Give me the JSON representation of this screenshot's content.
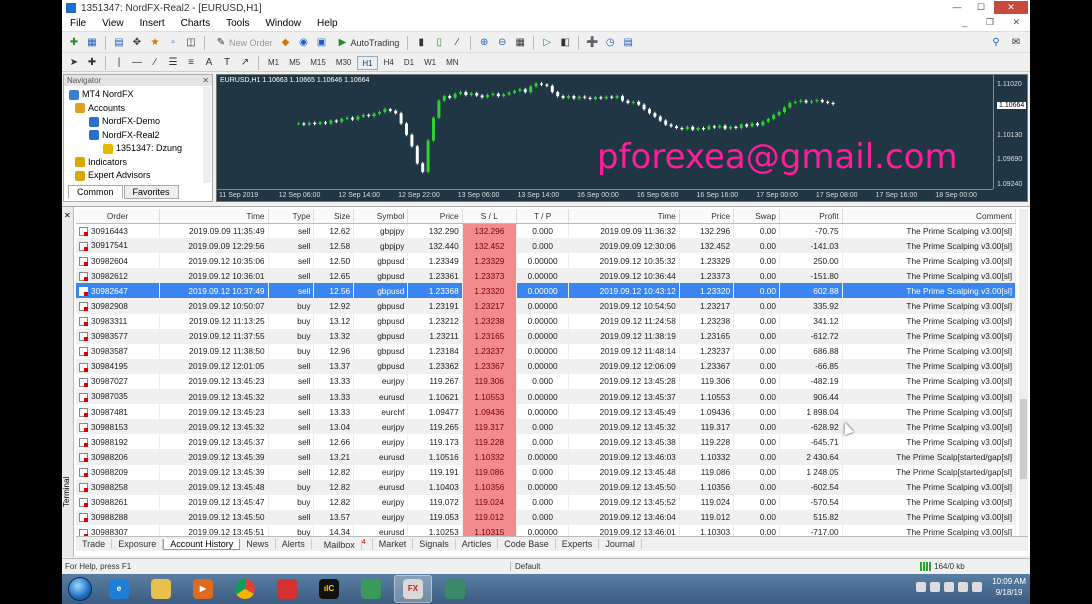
{
  "window": {
    "title": "1351347: NordFX-Real2 - [EURUSD,H1]",
    "controls": [
      "minimize",
      "maximize",
      "close"
    ]
  },
  "menu": [
    "File",
    "View",
    "Insert",
    "Charts",
    "Tools",
    "Window",
    "Help"
  ],
  "toolbar": {
    "new_order": "New Order",
    "auto_trading": "AutoTrading",
    "timeframes": [
      "M1",
      "M5",
      "M15",
      "M30",
      "H1",
      "H4",
      "D1",
      "W1",
      "MN"
    ],
    "active_timeframe": "H1"
  },
  "navigator": {
    "title": "Navigator",
    "items": [
      {
        "label": "MT4 NordFX",
        "icon": "terminal-icon"
      },
      {
        "label": "Accounts",
        "icon": "accounts-icon"
      },
      {
        "label": "NordFX-Demo",
        "icon": "server-icon"
      },
      {
        "label": "NordFX-Real2",
        "icon": "server-icon"
      },
      {
        "label": "1351347: Dzung",
        "icon": "lock-icon"
      },
      {
        "label": "Indicators",
        "icon": "indicators-icon"
      },
      {
        "label": "Expert Advisors",
        "icon": "expert-advisors-icon"
      }
    ],
    "tabs": [
      "Common",
      "Favorites"
    ],
    "active_tab": "Common"
  },
  "chart": {
    "header": "EURUSD,H1  1.10663 1.10665 1.10646 1.10664",
    "price_labels": [
      "1.11020",
      "1.10664",
      "1.10130",
      "1.09690",
      "1.09240"
    ],
    "current_price": "1.10664",
    "time_labels": [
      "11 Sep 2019",
      "12 Sep 06:00",
      "12 Sep 14:00",
      "12 Sep 22:00",
      "13 Sep 06:00",
      "13 Sep 14:00",
      "16 Sep 00:00",
      "16 Sep 08:00",
      "16 Sep 16:00",
      "17 Sep 00:00",
      "17 Sep 08:00",
      "17 Sep 16:00",
      "18 Sep 00:00"
    ],
    "watermark": "pforexea@gmail.com",
    "colors": {
      "background": "#203644",
      "bull": "#2ed12e",
      "bear": "#ffffff",
      "watermark": "#ff1e9a"
    }
  },
  "chart_data": {
    "type": "candlestick",
    "title": "EURUSD,H1  1.10663 1.10665 1.10646 1.10664",
    "ylim": [
      1.0915,
      1.1115
    ],
    "series": [
      {
        "name": "EURUSD,H1",
        "close": [
          1.103,
          1.1028,
          1.1031,
          1.1029,
          1.1032,
          1.103,
          1.1035,
          1.1033,
          1.1038,
          1.104,
          1.1037,
          1.1042,
          1.1045,
          1.1043,
          1.1047,
          1.105,
          1.1055,
          1.1052,
          1.1048,
          1.103,
          1.101,
          1.099,
          1.096,
          1.0945,
          1.1,
          1.104,
          1.107,
          1.1078,
          1.1075,
          1.1082,
          1.1085,
          1.108,
          1.1083,
          1.1079,
          1.1076,
          1.108,
          1.1082,
          1.1078,
          1.1081,
          1.1084,
          1.1087,
          1.109,
          1.1085,
          1.1095,
          1.11,
          1.1098,
          1.1096,
          1.1085,
          1.1078,
          1.1075,
          1.1078,
          1.1074,
          1.1077,
          1.1075,
          1.1073,
          1.1076,
          1.1074,
          1.1077,
          1.1075,
          1.1078,
          1.107,
          1.1066,
          1.1068,
          1.1063,
          1.1055,
          1.1048,
          1.1042,
          1.1035,
          1.1028,
          1.1025,
          1.1022,
          1.102,
          1.1024,
          1.1019,
          1.1022,
          1.102,
          1.1025,
          1.1023,
          1.1026,
          1.1021,
          1.1024,
          1.1022,
          1.1028,
          1.1025,
          1.103,
          1.1027,
          1.1033,
          1.1038,
          1.1045,
          1.105,
          1.1058,
          1.1066,
          1.1068,
          1.107,
          1.1067,
          1.1069,
          1.1071,
          1.1068,
          1.1066,
          1.1064
        ]
      }
    ]
  },
  "history": {
    "columns": [
      "Order",
      "Time",
      "Type",
      "Size",
      "Symbol",
      "Price",
      "S / L",
      "T / P",
      "Time",
      "Price",
      "Swap",
      "Profit",
      "Comment"
    ],
    "rows": [
      [
        "30916443",
        "2019.09.09 11:35:49",
        "sell",
        "12.62",
        "gbpjpy",
        "132.290",
        "132.296",
        "0.000",
        "2019.09.09 11:36:32",
        "132.296",
        "0.00",
        "-70.75",
        "The Prime Scalping v3.00[sl]"
      ],
      [
        "30917541",
        "2019.09.09 12:29:56",
        "sell",
        "12.58",
        "gbpjpy",
        "132.440",
        "132.452",
        "0.000",
        "2019.09.09 12:30:06",
        "132.452",
        "0.00",
        "-141.03",
        "The Prime Scalping v3.00[sl]"
      ],
      [
        "30982604",
        "2019.09.12 10:35:06",
        "sell",
        "12.50",
        "gbpusd",
        "1.23349",
        "1.23329",
        "0.00000",
        "2019.09.12 10:35:32",
        "1.23329",
        "0.00",
        "250.00",
        "The Prime Scalping v3.00[sl]"
      ],
      [
        "30982612",
        "2019.09.12 10:36:01",
        "sell",
        "12.65",
        "gbpusd",
        "1.23361",
        "1.23373",
        "0.00000",
        "2019.09.12 10:36:44",
        "1.23373",
        "0.00",
        "-151.80",
        "The Prime Scalping v3.00[sl]"
      ],
      [
        "30982647",
        "2019.09.12 10:37:49",
        "sell",
        "12.56",
        "gbpusd",
        "1.23368",
        "1.23320",
        "0.00000",
        "2019.09.12 10:43:12",
        "1.23320",
        "0.00",
        "602.88",
        "The Prime Scalping v3.00[sl]"
      ],
      [
        "30982908",
        "2019.09.12 10:50:07",
        "buy",
        "12.92",
        "gbpusd",
        "1.23191",
        "1.23217",
        "0.00000",
        "2019.09.12 10:54:50",
        "1.23217",
        "0.00",
        "335.92",
        "The Prime Scalping v3.00[sl]"
      ],
      [
        "30983311",
        "2019.09.12 11:13:25",
        "buy",
        "13.12",
        "gbpusd",
        "1.23212",
        "1.23238",
        "0.00000",
        "2019.09.12 11:24:58",
        "1.23238",
        "0.00",
        "341.12",
        "The Prime Scalping v3.00[sl]"
      ],
      [
        "30983577",
        "2019.09.12 11:37:55",
        "buy",
        "13.32",
        "gbpusd",
        "1.23211",
        "1.23165",
        "0.00000",
        "2019.09.12 11:38:19",
        "1.23165",
        "0.00",
        "-612.72",
        "The Prime Scalping v3.00[sl]"
      ],
      [
        "30983587",
        "2019.09.12 11:38:50",
        "buy",
        "12.96",
        "gbpusd",
        "1.23184",
        "1.23237",
        "0.00000",
        "2019.09.12 11:48:14",
        "1.23237",
        "0.00",
        "686.88",
        "The Prime Scalping v3.00[sl]"
      ],
      [
        "30984195",
        "2019.09.12 12:01:05",
        "sell",
        "13.37",
        "gbpusd",
        "1.23362",
        "1.23367",
        "0.00000",
        "2019.09.12 12:06:09",
        "1.23367",
        "0.00",
        "-66.85",
        "The Prime Scalping v3.00[sl]"
      ],
      [
        "30987027",
        "2019.09.12 13:45:23",
        "sell",
        "13.33",
        "eurjpy",
        "119.267",
        "119.306",
        "0.000",
        "2019.09.12 13:45:28",
        "119.306",
        "0.00",
        "-482.19",
        "The Prime Scalping v3.00[sl]"
      ],
      [
        "30987035",
        "2019.09.12 13:45:32",
        "sell",
        "13.33",
        "eurusd",
        "1.10621",
        "1.10553",
        "0.00000",
        "2019.09.12 13:45:37",
        "1.10553",
        "0.00",
        "906.44",
        "The Prime Scalping v3.00[sl]"
      ],
      [
        "30987481",
        "2019.09.12 13:45:23",
        "sell",
        "13.33",
        "eurchf",
        "1.09477",
        "1.09436",
        "0.00000",
        "2019.09.12 13:45:49",
        "1.09436",
        "0.00",
        "1 898.04",
        "The Prime Scalping v3.00[sl]"
      ],
      [
        "30988153",
        "2019.09.12 13:45:32",
        "sell",
        "13.04",
        "eurjpy",
        "119.265",
        "119.317",
        "0.000",
        "2019.09.12 13:45:32",
        "119.317",
        "0.00",
        "-628.92",
        "The Prime Scalping v3.00[sl]"
      ],
      [
        "30988192",
        "2019.09.12 13:45:37",
        "sell",
        "12.66",
        "eurjpy",
        "119.173",
        "119.228",
        "0.000",
        "2019.09.12 13:45:38",
        "119.228",
        "0.00",
        "-645.71",
        "The Prime Scalping v3.00[sl]"
      ],
      [
        "30988206",
        "2019.09.12 13:45:39",
        "sell",
        "13.21",
        "eurusd",
        "1.10516",
        "1.10332",
        "0.00000",
        "2019.09.12 13:46:03",
        "1.10332",
        "0.00",
        "2 430.64",
        "The Prime Scalp[started/gap[sl]"
      ],
      [
        "30988209",
        "2019.09.12 13:45:39",
        "sell",
        "12.82",
        "eurjpy",
        "119.191",
        "119.086",
        "0.000",
        "2019.09.12 13:45:48",
        "119.086",
        "0.00",
        "1 248.05",
        "The Prime Scalp[started/gap[sl]"
      ],
      [
        "30988258",
        "2019.09.12 13:45:48",
        "buy",
        "12.82",
        "eurusd",
        "1.10403",
        "1.10356",
        "0.00000",
        "2019.09.12 13:45:50",
        "1.10356",
        "0.00",
        "-602.54",
        "The Prime Scalping v3.00[sl]"
      ],
      [
        "30988261",
        "2019.09.12 13:45:47",
        "buy",
        "12.82",
        "eurjpy",
        "119.072",
        "119.024",
        "0.000",
        "2019.09.12 13:45:52",
        "119.024",
        "0.00",
        "-570.54",
        "The Prime Scalping v3.00[sl]"
      ],
      [
        "30988288",
        "2019.09.12 13:45:50",
        "sell",
        "13.57",
        "eurjpy",
        "119.053",
        "119.012",
        "0.000",
        "2019.09.12 13:46:04",
        "119.012",
        "0.00",
        "515.82",
        "The Prime Scalping v3.00[sl]"
      ],
      [
        "30988307",
        "2019.09.12 13:45:51",
        "buy",
        "14.34",
        "eurusd",
        "1.10253",
        "1.10315",
        "0.00000",
        "2019.09.12 13:46:01",
        "1.10303",
        "0.00",
        "-717.00",
        "The Prime Scalping v3.00[sl]"
      ]
    ],
    "selected_row": 4
  },
  "terminal": {
    "side_label": "Terminal",
    "tabs": [
      "Trade",
      "Exposure",
      "Account History",
      "News",
      "Alerts",
      "Mailbox",
      "Market",
      "Signals",
      "Articles",
      "Code Base",
      "Experts",
      "Journal"
    ],
    "active_tab": "Account History",
    "mailbox_badge": "4"
  },
  "status": {
    "help": "For Help, press F1",
    "profile": "Default",
    "traffic": "164/0 kb"
  },
  "taskbar": {
    "apps": [
      {
        "icon": "internet-explorer-icon",
        "label": "e"
      },
      {
        "icon": "file-explorer-icon",
        "label": ""
      },
      {
        "icon": "media-player-icon",
        "label": "▶"
      },
      {
        "icon": "chrome-icon",
        "label": ""
      },
      {
        "icon": "app-red-icon",
        "label": ""
      },
      {
        "icon": "app-chart-icon",
        "label": "ılC"
      },
      {
        "icon": "app-globe-icon",
        "label": ""
      },
      {
        "icon": "metatrader-icon",
        "label": "FX"
      },
      {
        "icon": "app-globe2-icon",
        "label": ""
      }
    ],
    "active_app": 7,
    "time": "10:09 AM",
    "date": "9/18/19"
  }
}
